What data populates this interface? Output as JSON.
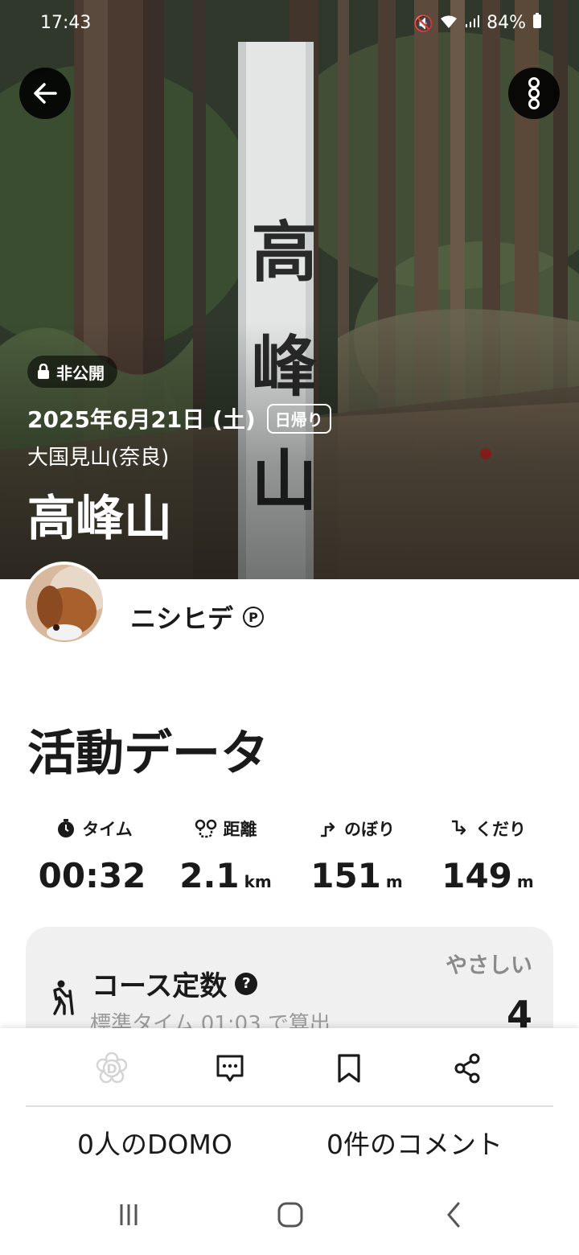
{
  "status_bar": {
    "time": "17:43",
    "battery": "84%"
  },
  "header": {
    "private_label": "非公開",
    "date": "2025年6月21日 (土)",
    "trip_type": "日帰り",
    "area": "大国見山(奈良)",
    "mountain": "高峰山",
    "signpost_text": "高峰山"
  },
  "user": {
    "name": "ニシヒデ",
    "badge": "P"
  },
  "activity": {
    "title": "活動データ",
    "stats": [
      {
        "label": "タイム",
        "value": "00:32",
        "unit": "",
        "icon": "stopwatch-icon"
      },
      {
        "label": "距離",
        "value": "2.1",
        "unit": "km",
        "icon": "route-icon"
      },
      {
        "label": "のぼり",
        "value": "151",
        "unit": "m",
        "icon": "ascent-icon"
      },
      {
        "label": "くだり",
        "value": "149",
        "unit": "m",
        "icon": "descent-icon"
      }
    ]
  },
  "course": {
    "title": "コース定数",
    "help": "?",
    "subtitle": "標準タイム 01:03 で算出",
    "difficulty": "やさしい",
    "value": "4"
  },
  "actions": {
    "domo_count": "0人のDOMO",
    "comment_count": "0件のコメント",
    "domo_glyph": "D"
  },
  "colors": {
    "text": "#1a1a1a",
    "card": "#f0f0f0",
    "muted": "#9a9a9a"
  }
}
